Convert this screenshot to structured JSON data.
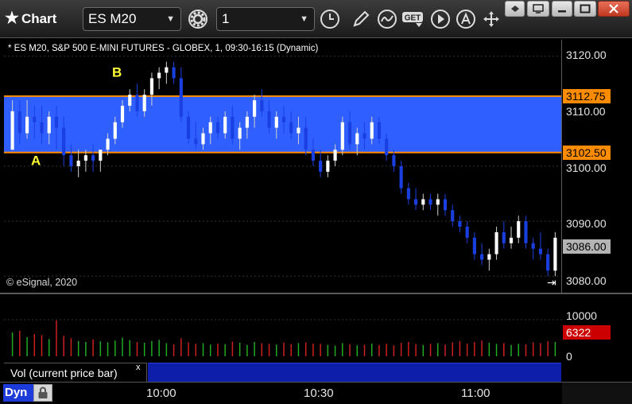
{
  "window": {
    "title": "Chart",
    "symbol_value": "ES M20",
    "interval_value": "1"
  },
  "toolbar_icons": [
    "settings-gear-icon",
    "clock-icon",
    "pencil-icon",
    "study-wave-icon",
    "get-icon",
    "play-icon",
    "alert-icon",
    "cursor-move-icon"
  ],
  "window_controls": [
    "restore-icon",
    "detach-icon",
    "maximize-icon",
    "close-icon"
  ],
  "chart": {
    "description": "* ES M20, S&P 500 E-MINI FUTURES - GLOBEX, 1, 09:30-16:15 (Dynamic)",
    "copyright": "© eSignal, 2020",
    "colors": {
      "up_bar": "#ffffff",
      "down_bar": "#1a3fe0",
      "zone_fill": "#2f60ff",
      "zone_line": "#ff8c00",
      "label_color": "#ffff33",
      "vol_up": "#22aa22",
      "vol_down": "#cc2020"
    },
    "price_ticks": [
      "3120.00",
      "3110.00",
      "3100.00",
      "3090.00",
      "3080.00"
    ],
    "zone_top_tag": "3112.75",
    "zone_bottom_tag": "3102.50",
    "last_price_tag": "3086.00",
    "annotation_a": "A",
    "annotation_b": "B",
    "volume_ticks": [
      "10000",
      "0"
    ],
    "volume_last_tag": "6322",
    "volume_legend": "Vol (current price bar)",
    "volume_close": "x",
    "time_ticks": [
      "10:00",
      "10:30",
      "11:00"
    ],
    "dyn_label": "Dyn"
  },
  "chart_data": {
    "type": "candlestick",
    "title": "",
    "y_ticks": [
      3120,
      3110,
      3100,
      3090,
      3080
    ],
    "ylim": [
      3077,
      3123
    ],
    "zone": [
      3102.5,
      3112.75
    ],
    "last_price": 3086,
    "x_ticks": [
      "10:00",
      "10:30",
      "11:00"
    ],
    "volume_ticks": [
      0,
      10000
    ],
    "volume_last": 6322,
    "ohlc": [
      [
        3103,
        3112,
        3103,
        3110
      ],
      [
        3110,
        3112,
        3104,
        3106
      ],
      [
        3106,
        3112,
        3105,
        3109
      ],
      [
        3109,
        3111,
        3105,
        3108
      ],
      [
        3108,
        3111,
        3104,
        3106
      ],
      [
        3106,
        3110,
        3104,
        3109
      ],
      [
        3109,
        3111,
        3103,
        3107
      ],
      [
        3107,
        3109,
        3100,
        3102
      ],
      [
        3102,
        3104,
        3099,
        3100
      ],
      [
        3100,
        3103,
        3098,
        3101
      ],
      [
        3101,
        3103,
        3099,
        3102
      ],
      [
        3102,
        3104,
        3099,
        3101
      ],
      [
        3101,
        3103,
        3099,
        3103
      ],
      [
        3103,
        3106,
        3102,
        3105
      ],
      [
        3105,
        3109,
        3104,
        3108
      ],
      [
        3108,
        3112,
        3107,
        3111
      ],
      [
        3111,
        3114,
        3110,
        3113
      ],
      [
        3113,
        3115,
        3109,
        3110
      ],
      [
        3110,
        3114,
        3109,
        3113
      ],
      [
        3113,
        3117,
        3111,
        3116
      ],
      [
        3116,
        3118,
        3114,
        3117
      ],
      [
        3117,
        3119,
        3115,
        3118
      ],
      [
        3118,
        3119,
        3115,
        3116
      ],
      [
        3116,
        3118,
        3108,
        3109
      ],
      [
        3109,
        3110,
        3104,
        3105
      ],
      [
        3105,
        3108,
        3103,
        3104
      ],
      [
        3104,
        3107,
        3103,
        3106
      ],
      [
        3106,
        3109,
        3104,
        3108
      ],
      [
        3108,
        3109,
        3105,
        3106
      ],
      [
        3106,
        3110,
        3105,
        3109
      ],
      [
        3109,
        3111,
        3104,
        3105
      ],
      [
        3105,
        3108,
        3103,
        3107
      ],
      [
        3107,
        3110,
        3105,
        3109
      ],
      [
        3109,
        3113,
        3107,
        3112
      ],
      [
        3112,
        3114,
        3109,
        3110
      ],
      [
        3110,
        3112,
        3106,
        3107
      ],
      [
        3107,
        3110,
        3105,
        3109
      ],
      [
        3109,
        3111,
        3106,
        3108
      ],
      [
        3108,
        3110,
        3105,
        3106
      ],
      [
        3106,
        3109,
        3104,
        3107
      ],
      [
        3107,
        3109,
        3102,
        3103
      ],
      [
        3103,
        3105,
        3100,
        3101
      ],
      [
        3101,
        3103,
        3098,
        3099
      ],
      [
        3099,
        3102,
        3098,
        3101
      ],
      [
        3101,
        3104,
        3100,
        3103
      ],
      [
        3103,
        3109,
        3102,
        3108
      ],
      [
        3108,
        3110,
        3103,
        3104
      ],
      [
        3104,
        3107,
        3102,
        3106
      ],
      [
        3106,
        3108,
        3103,
        3105
      ],
      [
        3105,
        3109,
        3104,
        3108
      ],
      [
        3108,
        3109,
        3104,
        3105
      ],
      [
        3105,
        3106,
        3101,
        3102
      ],
      [
        3102,
        3103,
        3099,
        3100
      ],
      [
        3100,
        3101,
        3095,
        3096
      ],
      [
        3096,
        3097,
        3093,
        3094
      ],
      [
        3094,
        3096,
        3092,
        3093
      ],
      [
        3093,
        3095,
        3092,
        3094
      ],
      [
        3094,
        3095,
        3092,
        3093
      ],
      [
        3093,
        3095,
        3091,
        3094
      ],
      [
        3094,
        3095,
        3091,
        3092
      ],
      [
        3092,
        3093,
        3089,
        3090
      ],
      [
        3090,
        3091,
        3088,
        3089
      ],
      [
        3089,
        3090,
        3086,
        3087
      ],
      [
        3087,
        3088,
        3083,
        3084
      ],
      [
        3084,
        3086,
        3082,
        3083
      ],
      [
        3083,
        3085,
        3081,
        3084
      ],
      [
        3084,
        3089,
        3083,
        3088
      ],
      [
        3088,
        3090,
        3085,
        3086
      ],
      [
        3086,
        3089,
        3085,
        3087
      ],
      [
        3087,
        3091,
        3086,
        3090
      ],
      [
        3090,
        3091,
        3085,
        3086
      ],
      [
        3086,
        3087,
        3083,
        3085
      ],
      [
        3085,
        3088,
        3083,
        3084
      ],
      [
        3084,
        3085,
        3080,
        3081
      ],
      [
        3081,
        3088,
        3080,
        3087
      ]
    ],
    "volume": [
      6500,
      7000,
      5200,
      6100,
      5800,
      4700,
      9800,
      5600,
      4900,
      4200,
      3900,
      4600,
      4100,
      3800,
      4300,
      5100,
      4400,
      3900,
      3700,
      4200,
      4500,
      3600,
      3300,
      4900,
      3800,
      3400,
      3600,
      3200,
      3500,
      3300,
      4000,
      3700,
      3100,
      3900,
      3600,
      3400,
      3200,
      3700,
      3300,
      3600,
      3800,
      3500,
      3400,
      3100,
      2900,
      3600,
      3300,
      3000,
      3200,
      3500,
      3100,
      3400,
      3000,
      3700,
      3900,
      3300,
      3100,
      3400,
      3600,
      3200,
      3800,
      4100,
      3500,
      3900,
      4300,
      3700,
      3400,
      3600,
      3100,
      3400,
      3300,
      3800,
      3600,
      4100,
      3900
    ]
  }
}
